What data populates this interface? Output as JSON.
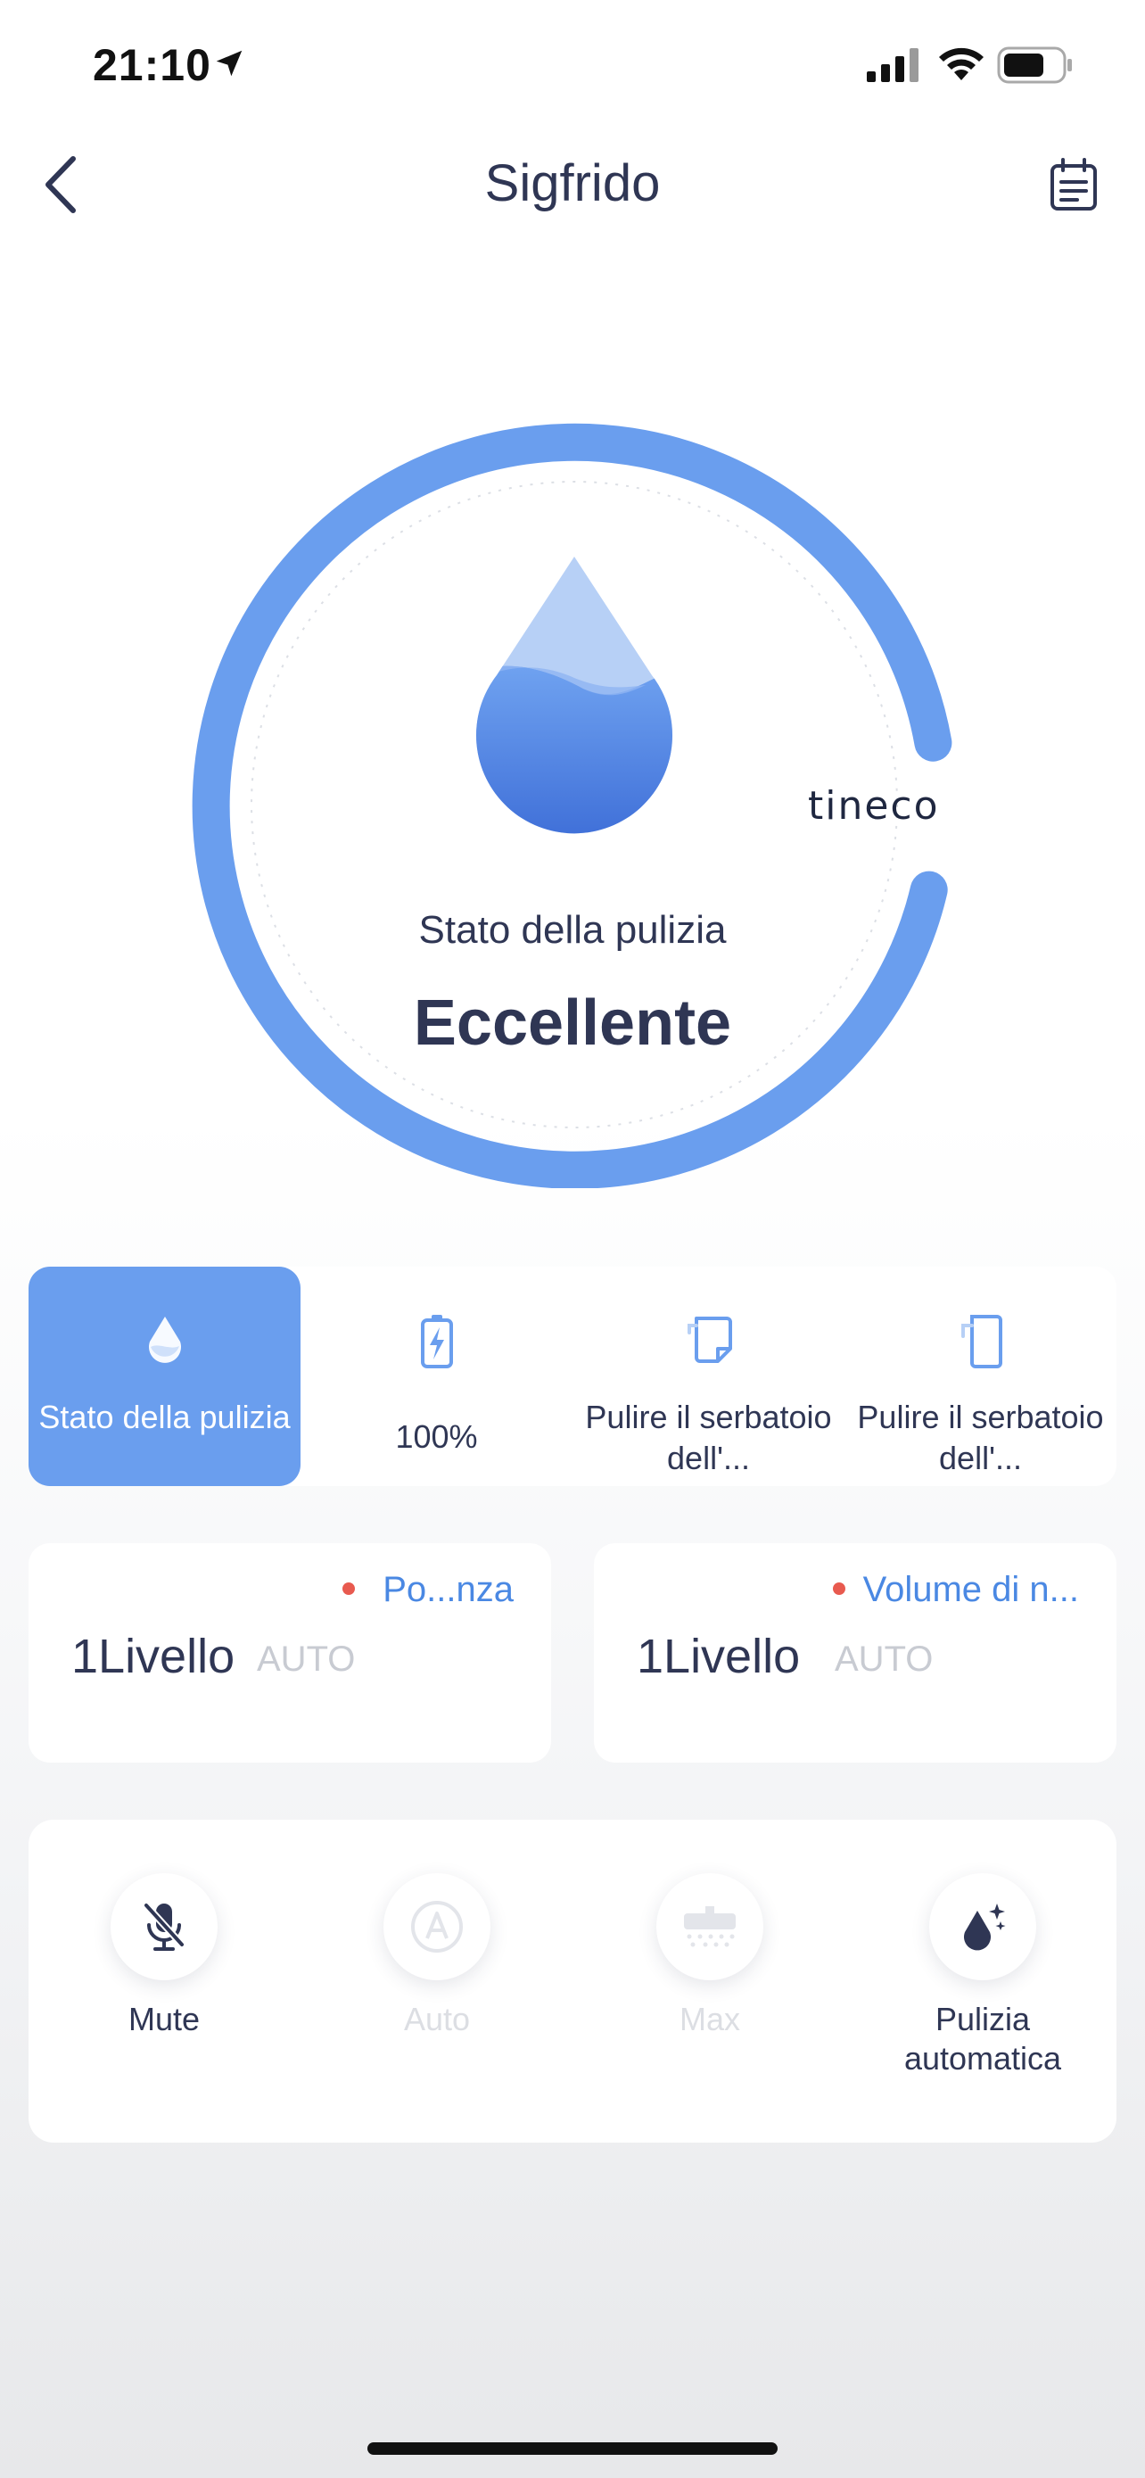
{
  "status_bar": {
    "time": "21:10"
  },
  "header": {
    "title": "Sigfrido"
  },
  "gauge": {
    "label": "Stato della pulizia",
    "value": "Eccellente",
    "brand": "tineco",
    "accent_color": "#6a9eee"
  },
  "tabs": [
    {
      "label": "Stato della pulizia",
      "icon": "water-drop-icon",
      "active": true
    },
    {
      "label": "100%",
      "icon": "battery-charging-icon",
      "active": false
    },
    {
      "label": "Pulire il serbatoio dell'...",
      "icon": "dirty-tank-icon",
      "active": false
    },
    {
      "label": "Pulire il serbatoio dell'...",
      "icon": "clean-tank-icon",
      "active": false
    }
  ],
  "level_cards": [
    {
      "tag": "Po...nza",
      "level": "1Livello",
      "mode": "AUTO"
    },
    {
      "tag": "Volume di n...",
      "level": "1Livello",
      "mode": "AUTO"
    }
  ],
  "actions": [
    {
      "label": "Mute",
      "icon": "mic-off-icon",
      "enabled": true
    },
    {
      "label": "Auto",
      "icon": "auto-mode-icon",
      "enabled": false
    },
    {
      "label": "Max",
      "icon": "max-mode-icon",
      "enabled": false
    },
    {
      "label": "Pulizia automatica",
      "icon": "self-clean-icon",
      "enabled": true
    }
  ]
}
